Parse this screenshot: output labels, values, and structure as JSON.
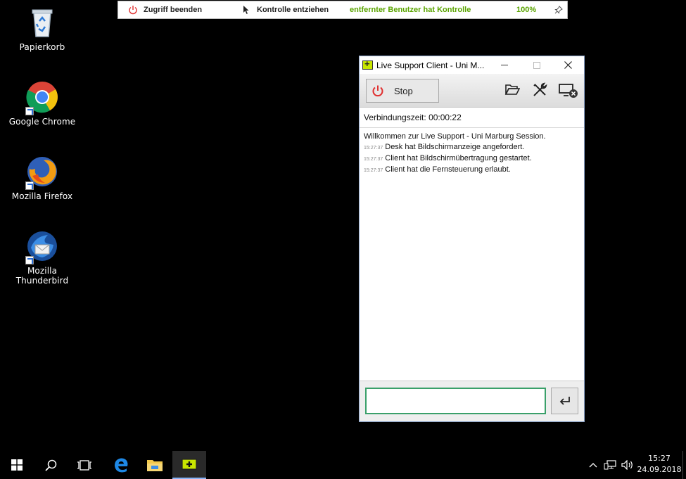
{
  "desktop": {
    "icons": [
      {
        "label": "Papierkorb"
      },
      {
        "label": "Google Chrome"
      },
      {
        "label": "Mozilla Firefox"
      },
      {
        "label": "Mozilla Thunderbird"
      }
    ]
  },
  "remote_bar": {
    "end_access": "Zugriff beenden",
    "revoke_control": "Kontrolle entziehen",
    "status": "entfernter Benutzer hat Kontrolle",
    "zoom": "100%"
  },
  "window": {
    "title": "Live Support Client - Uni M...",
    "stop_label": "Stop",
    "connection_time": "Verbindungszeit: 00:00:22",
    "welcome": "Willkommen zur Live Support - Uni Marburg Session.",
    "log": [
      {
        "time": "15:27:37",
        "text": "Desk hat Bildschirmanzeige angefordert."
      },
      {
        "time": "15:27:37",
        "text": "Client hat Bildschirmübertragung gestartet."
      },
      {
        "time": "15:27:37",
        "text": "Client hat die Fernsteuerung erlaubt."
      }
    ],
    "input_value": ""
  },
  "taskbar": {
    "time": "15:27",
    "date": "24.09.2018"
  },
  "colors": {
    "accent_green": "#5aa400",
    "input_border": "#3aa06a",
    "stop_red": "#e03030"
  }
}
